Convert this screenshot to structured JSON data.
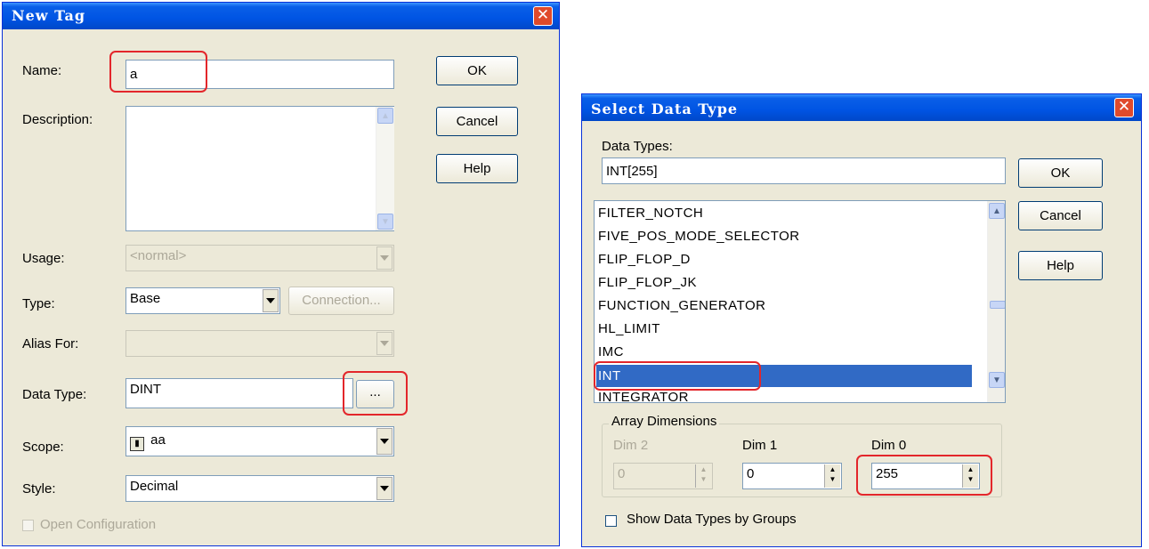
{
  "new_tag": {
    "title": "New Tag",
    "ok_label": "OK",
    "cancel_label": "Cancel",
    "help_label": "Help",
    "name_label": "Name:",
    "name_value": "a",
    "description_label": "Description:",
    "description_value": "",
    "usage_label": "Usage:",
    "usage_value": "<normal>",
    "type_label": "Type:",
    "type_value": "Base",
    "connection_label": "Connection...",
    "alias_label": "Alias For:",
    "alias_value": "",
    "datatype_label": "Data Type:",
    "datatype_value": "DINT",
    "browse_label": "...",
    "scope_label": "Scope:",
    "scope_value": "aa",
    "style_label": "Style:",
    "style_value": "Decimal",
    "open_config_label": "Open Configuration"
  },
  "select_data_type": {
    "title": "Select Data Type",
    "data_types_label": "Data Types:",
    "data_types_value": "INT[255]",
    "ok_label": "OK",
    "cancel_label": "Cancel",
    "help_label": "Help",
    "list_items": [
      "FILTER_NOTCH",
      "FIVE_POS_MODE_SELECTOR",
      "FLIP_FLOP_D",
      "FLIP_FLOP_JK",
      "FUNCTION_GENERATOR",
      "HL_LIMIT",
      "IMC",
      "INT",
      "INTEGRATOR"
    ],
    "selected_item": "INT",
    "array_dimensions_label": "Array Dimensions",
    "dim2_label": "Dim 2",
    "dim2_value": "0",
    "dim1_label": "Dim 1",
    "dim1_value": "0",
    "dim0_label": "Dim 0",
    "dim0_value": "255",
    "show_groups_label": "Show Data Types by Groups"
  },
  "colors": {
    "title_bar": "#0054e3",
    "dialog_bg": "#ece9d8",
    "selection": "#316ac5",
    "highlight_box": "#e3262b"
  }
}
